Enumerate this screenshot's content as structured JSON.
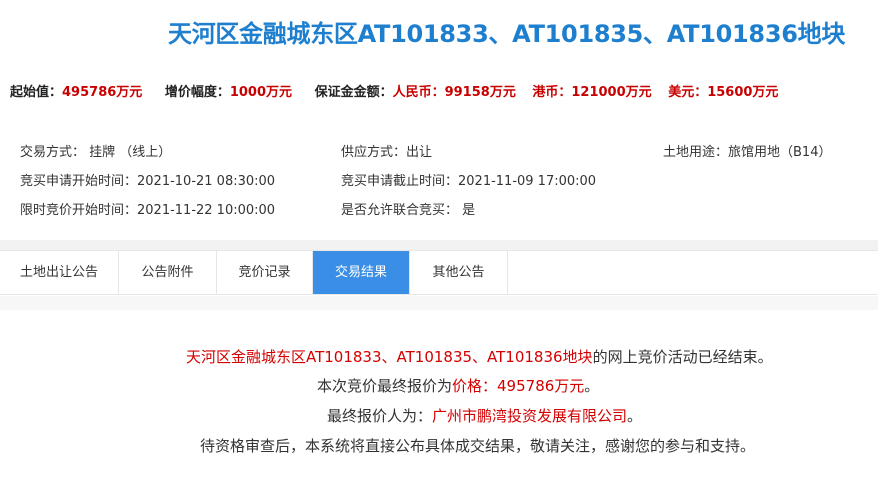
{
  "header": {
    "title": "天河区金融城东区AT101833、AT101835、AT101836地块"
  },
  "price_bar": {
    "start_label": "起始值：",
    "start_value": "495786万元",
    "increment_label": "增价幅度：",
    "increment_value": "1000万元",
    "deposit_label": "保证金金额：",
    "rmb_label": "人民币：",
    "rmb_value": "99158万元",
    "hkd_label": "港币：",
    "hkd_value": "121000万元",
    "usd_label": "美元：",
    "usd_value": "15600万元"
  },
  "info": {
    "trade_method": "交易方式：  挂牌 （线上）",
    "supply_method": "供应方式：出让",
    "land_use": "土地用途：旅馆用地（B14）",
    "apply_start": "竞买申请开始时间：2021-10-21 08:30:00",
    "apply_end": "竞买申请截止时间：2021-11-09 17:00:00",
    "bid_start": "限时竞价开始时间：2021-11-22 10:00:00",
    "joint_bid": "是否允许联合竞买： 是"
  },
  "tabs": [
    {
      "label": "土地出让公告"
    },
    {
      "label": "公告附件"
    },
    {
      "label": "竞价记录"
    },
    {
      "label": "交易结果"
    },
    {
      "label": "其他公告"
    }
  ],
  "result": {
    "line1_red": "天河区金融城东区AT101833、AT101835、AT101836地块",
    "line1_tail": "的网上竞价活动已经结束。",
    "line2_head": "本次竞价最终报价为",
    "line2_red": "价格：495786万元",
    "line2_tail": "。",
    "line3_head": "最终报价人为：",
    "line3_red": "广州市鹏湾投资发展有限公司",
    "line3_tail": "。",
    "line4": "待资格审查后，本系统将直接公布具体成交结果，敬请关注，感谢您的参与和支持。"
  },
  "colors": {
    "title_blue": "#1e7fcf",
    "value_red": "#c80000",
    "active_tab": "#3a8ee6"
  }
}
